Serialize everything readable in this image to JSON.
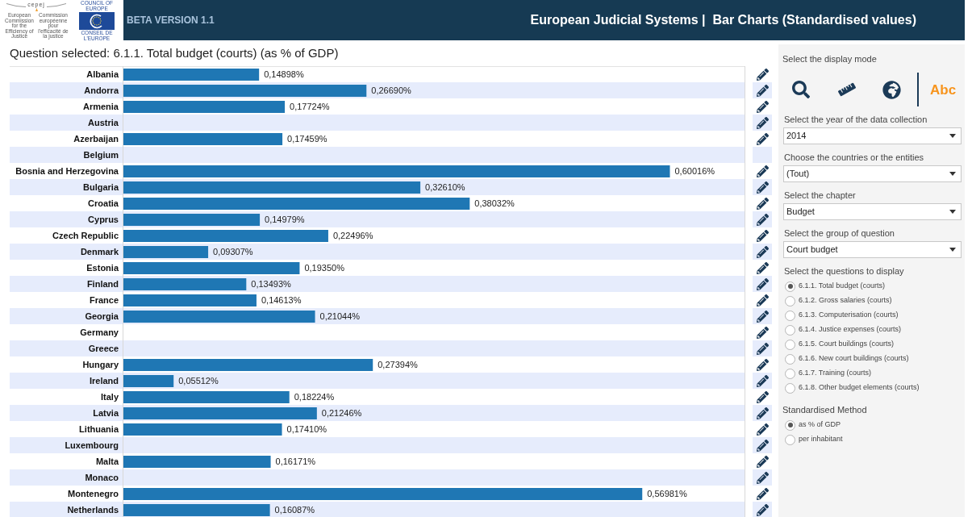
{
  "header": {
    "cepej_logo": {
      "name": "cepej",
      "caption_en": "European Commission for the Efficiency of Justice",
      "caption_fr": "Commission européenne pour l'efficacité de la justice"
    },
    "coe_logo": {
      "top": "COUNCIL OF EUROPE",
      "bottom": "CONSEIL DE L'EUROPE"
    },
    "version": "BETA VERSION 1.1",
    "title": "European Judicial Systems |  Bar Charts (Standardised values)"
  },
  "chart": {
    "title": "Question selected: 6.1.1. Total budget (courts) (as % of GDP)",
    "chart_data": {
      "type": "bar",
      "orientation": "horizontal",
      "categories": [
        "Albania",
        "Andorra",
        "Armenia",
        "Austria",
        "Azerbaijan",
        "Belgium",
        "Bosnia and Herzegovina",
        "Bulgaria",
        "Croatia",
        "Cyprus",
        "Czech Republic",
        "Denmark",
        "Estonia",
        "Finland",
        "France",
        "Georgia",
        "Germany",
        "Greece",
        "Hungary",
        "Ireland",
        "Italy",
        "Latvia",
        "Lithuania",
        "Luxembourg",
        "Malta",
        "Monaco",
        "Montenegro",
        "Netherlands"
      ],
      "values": [
        0.14898,
        0.2669,
        0.17724,
        null,
        0.17459,
        null,
        0.60016,
        0.3261,
        0.38032,
        0.14979,
        0.22496,
        0.09307,
        0.1935,
        0.13493,
        0.14613,
        0.21044,
        null,
        null,
        0.27394,
        0.05512,
        0.18224,
        0.21246,
        0.1741,
        null,
        0.16171,
        null,
        0.56981,
        0.16087
      ],
      "value_labels": [
        "0,14898%",
        "0,26690%",
        "0,17724%",
        null,
        "0,17459%",
        null,
        "0,60016%",
        "0,32610%",
        "0,38032%",
        "0,14979%",
        "0,22496%",
        "0,09307%",
        "0,19350%",
        "0,13493%",
        "0,14613%",
        "0,21044%",
        null,
        null,
        "0,27394%",
        "0,05512%",
        "0,18224%",
        "0,21246%",
        "0,17410%",
        null,
        "0,16171%",
        null,
        "0,56981%",
        "0,16087%"
      ],
      "color": "#1f77b4",
      "xlim": [
        0,
        0.683
      ]
    },
    "edit_buttons": [
      {
        "shown": true
      },
      {
        "shown": true
      },
      {
        "shown": true
      },
      {
        "shown": true
      },
      {
        "shown": true
      },
      {
        "shown": false
      },
      {
        "shown": true
      },
      {
        "shown": true
      },
      {
        "shown": true
      },
      {
        "shown": true
      },
      {
        "shown": true
      },
      {
        "shown": true
      },
      {
        "shown": true
      },
      {
        "shown": true
      },
      {
        "shown": true
      },
      {
        "shown": true
      },
      {
        "shown": true
      },
      {
        "shown": true
      },
      {
        "shown": true
      },
      {
        "shown": true
      },
      {
        "shown": true
      },
      {
        "shown": true
      },
      {
        "shown": true
      },
      {
        "shown": true
      },
      {
        "shown": true
      },
      {
        "shown": true
      },
      {
        "shown": true
      },
      {
        "shown": true
      }
    ]
  },
  "panel": {
    "display_mode": {
      "label": "Select the display mode",
      "modes": [
        {
          "kind": "search",
          "selected": false
        },
        {
          "kind": "ruler",
          "selected": false
        },
        {
          "kind": "globe",
          "selected": false
        },
        {
          "kind": "text",
          "label": "Abc",
          "selected": true
        }
      ]
    },
    "filters": [
      {
        "label": "Select the year of the data collection",
        "value": "2014"
      },
      {
        "label": "Choose the countries or the entities",
        "value": "(Tout)"
      },
      {
        "label": "Select the chapter",
        "value": "Budget"
      },
      {
        "label": "Select the group of question",
        "value": "Court budget"
      }
    ],
    "questions": {
      "label": "Select the questions to display",
      "options": [
        {
          "label": "6.1.1. Total budget (courts)",
          "selected": true
        },
        {
          "label": "6.1.2. Gross salaries (courts)",
          "selected": false
        },
        {
          "label": "6.1.3. Computerisation (courts)",
          "selected": false
        },
        {
          "label": "6.1.4. Justice expenses (courts)",
          "selected": false
        },
        {
          "label": "6.1.5. Court buildings (courts)",
          "selected": false
        },
        {
          "label": "6.1.6. New court buildings (courts)",
          "selected": false
        },
        {
          "label": "6.1.7. Training (courts)",
          "selected": false
        },
        {
          "label": "6.1.8. Other budget elements (courts)",
          "selected": false
        }
      ]
    },
    "method": {
      "label": "Standardised Method",
      "options": [
        {
          "label": "as % of GDP",
          "selected": true
        },
        {
          "label": "per inhabitant",
          "selected": false
        }
      ]
    }
  }
}
